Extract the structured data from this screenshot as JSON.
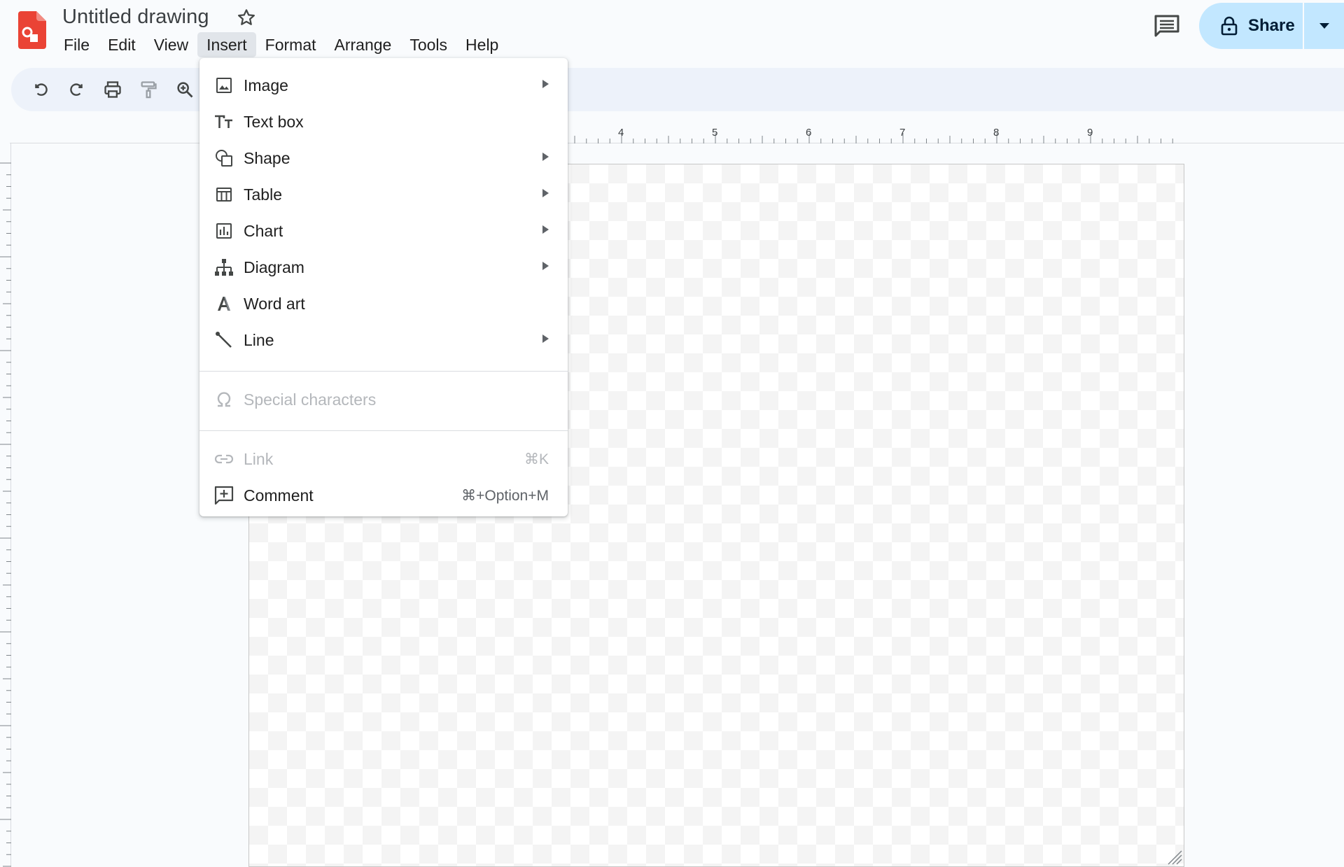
{
  "app": {
    "title": "Untitled drawing",
    "brand_color": "#ea4335"
  },
  "menubar": {
    "items": [
      {
        "label": "File"
      },
      {
        "label": "Edit"
      },
      {
        "label": "View"
      },
      {
        "label": "Insert",
        "active": true
      },
      {
        "label": "Format"
      },
      {
        "label": "Arrange"
      },
      {
        "label": "Tools"
      },
      {
        "label": "Help"
      }
    ]
  },
  "header": {
    "share_label": "Share",
    "share_color": "#c2e7ff"
  },
  "toolbar": {
    "icons": [
      "undo-icon",
      "redo-icon",
      "print-icon",
      "paint-format-icon",
      "zoom-icon"
    ]
  },
  "ruler": {
    "top_labels": [
      "4",
      "5",
      "6",
      "7",
      "8",
      "9"
    ]
  },
  "insert_menu": {
    "items": [
      {
        "label": "Image",
        "icon": "image-icon",
        "submenu": true
      },
      {
        "label": "Text box",
        "icon": "text-box-icon",
        "submenu": false
      },
      {
        "label": "Shape",
        "icon": "shape-icon",
        "submenu": true
      },
      {
        "label": "Table",
        "icon": "table-icon",
        "submenu": true
      },
      {
        "label": "Chart",
        "icon": "chart-icon",
        "submenu": true
      },
      {
        "label": "Diagram",
        "icon": "diagram-icon",
        "submenu": true
      },
      {
        "label": "Word art",
        "icon": "word-art-icon",
        "submenu": false
      },
      {
        "label": "Line",
        "icon": "line-icon",
        "submenu": true
      }
    ],
    "special_characters": {
      "label": "Special characters",
      "icon": "omega-icon",
      "disabled": true
    },
    "link": {
      "label": "Link",
      "shortcut": "⌘K",
      "icon": "link-icon",
      "disabled": true
    },
    "comment": {
      "label": "Comment",
      "shortcut": "⌘+Option+M",
      "icon": "add-comment-icon"
    }
  }
}
